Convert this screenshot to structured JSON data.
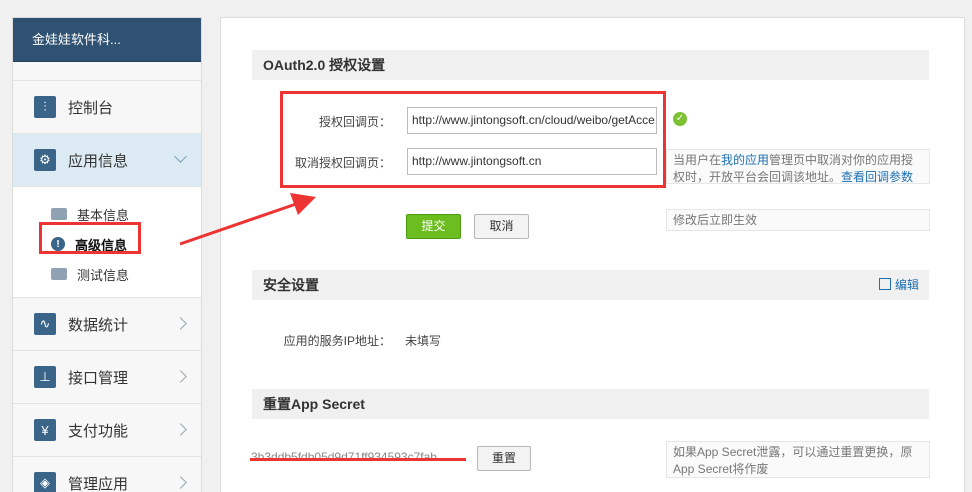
{
  "sidebar": {
    "app_name": "金娃娃软件科...",
    "items": [
      {
        "label": "控制台",
        "icon": "dashboard-icon",
        "glyph": "⫶"
      },
      {
        "label": "应用信息",
        "icon": "gear-icon",
        "glyph": "⚙"
      },
      {
        "label": "数据统计",
        "icon": "chart-icon",
        "glyph": "📈"
      },
      {
        "label": "接口管理",
        "icon": "plug-icon",
        "glyph": "⏚"
      },
      {
        "label": "支付功能",
        "icon": "yen-icon",
        "glyph": "¥"
      },
      {
        "label": "管理应用",
        "icon": "layers-icon",
        "glyph": "◈"
      }
    ],
    "subitems": [
      {
        "label": "基本信息"
      },
      {
        "label": "高级信息"
      },
      {
        "label": "测试信息"
      }
    ]
  },
  "oauth": {
    "title": "OAuth2.0 授权设置",
    "callback_label": "授权回调页：",
    "callback_value": "http://www.jintongsoft.cn/cloud/weibo/getAcce",
    "cancel_label": "取消授权回调页：",
    "cancel_value": "http://www.jintongsoft.cn",
    "hint_prefix": "当用户在",
    "hint_link1": "我的应用",
    "hint_middle": "管理页中取消对你的应用授权时，开放平台会回调该地址。",
    "hint_link2": "查看回调参数",
    "submit": "提交",
    "cancel": "取消",
    "effect_hint": "修改后立即生效"
  },
  "security": {
    "title": "安全设置",
    "edit": "编辑",
    "ip_label": "应用的服务IP地址：",
    "ip_value": "未填写"
  },
  "secret": {
    "title": "重置App Secret",
    "value": "3b3ddb5fdb05d9d71ff934593c7fab",
    "reset": "重置",
    "hint": "如果App Secret泄露，可以通过重置更换，原App Secret将作废"
  }
}
